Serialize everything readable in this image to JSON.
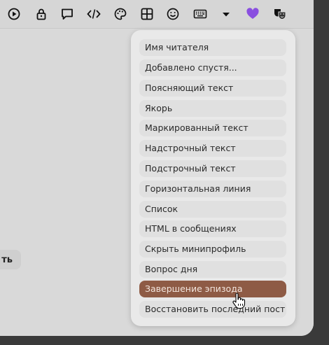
{
  "toolbar": {
    "icons": [
      "play-circle-icon",
      "lock-icon",
      "speech-bubble-icon",
      "code-icon",
      "palette-icon",
      "table-icon",
      "smiley-icon",
      "keyboard-icon",
      "dropdown-triangle-icon",
      "purple-heart-icon",
      "theater-masks-icon"
    ]
  },
  "side_button": {
    "label": "ть"
  },
  "menu": {
    "items": [
      "Имя читателя",
      "Добавлено спустя...",
      "Поясняющий текст",
      "Якорь",
      "Маркированный текст",
      "Надстрочный текст",
      "Подстрочный текст",
      "Горизонтальная линия",
      "Список",
      "HTML в сообщениях",
      "Скрыть минипрофиль",
      "Вопрос дня",
      "Завершение эпизода",
      "Восстановить последний пост"
    ],
    "active_item": "Завершение эпизода"
  },
  "colors": {
    "active_item_bg": "#8e5b45",
    "heart": "#8a4fe0"
  }
}
